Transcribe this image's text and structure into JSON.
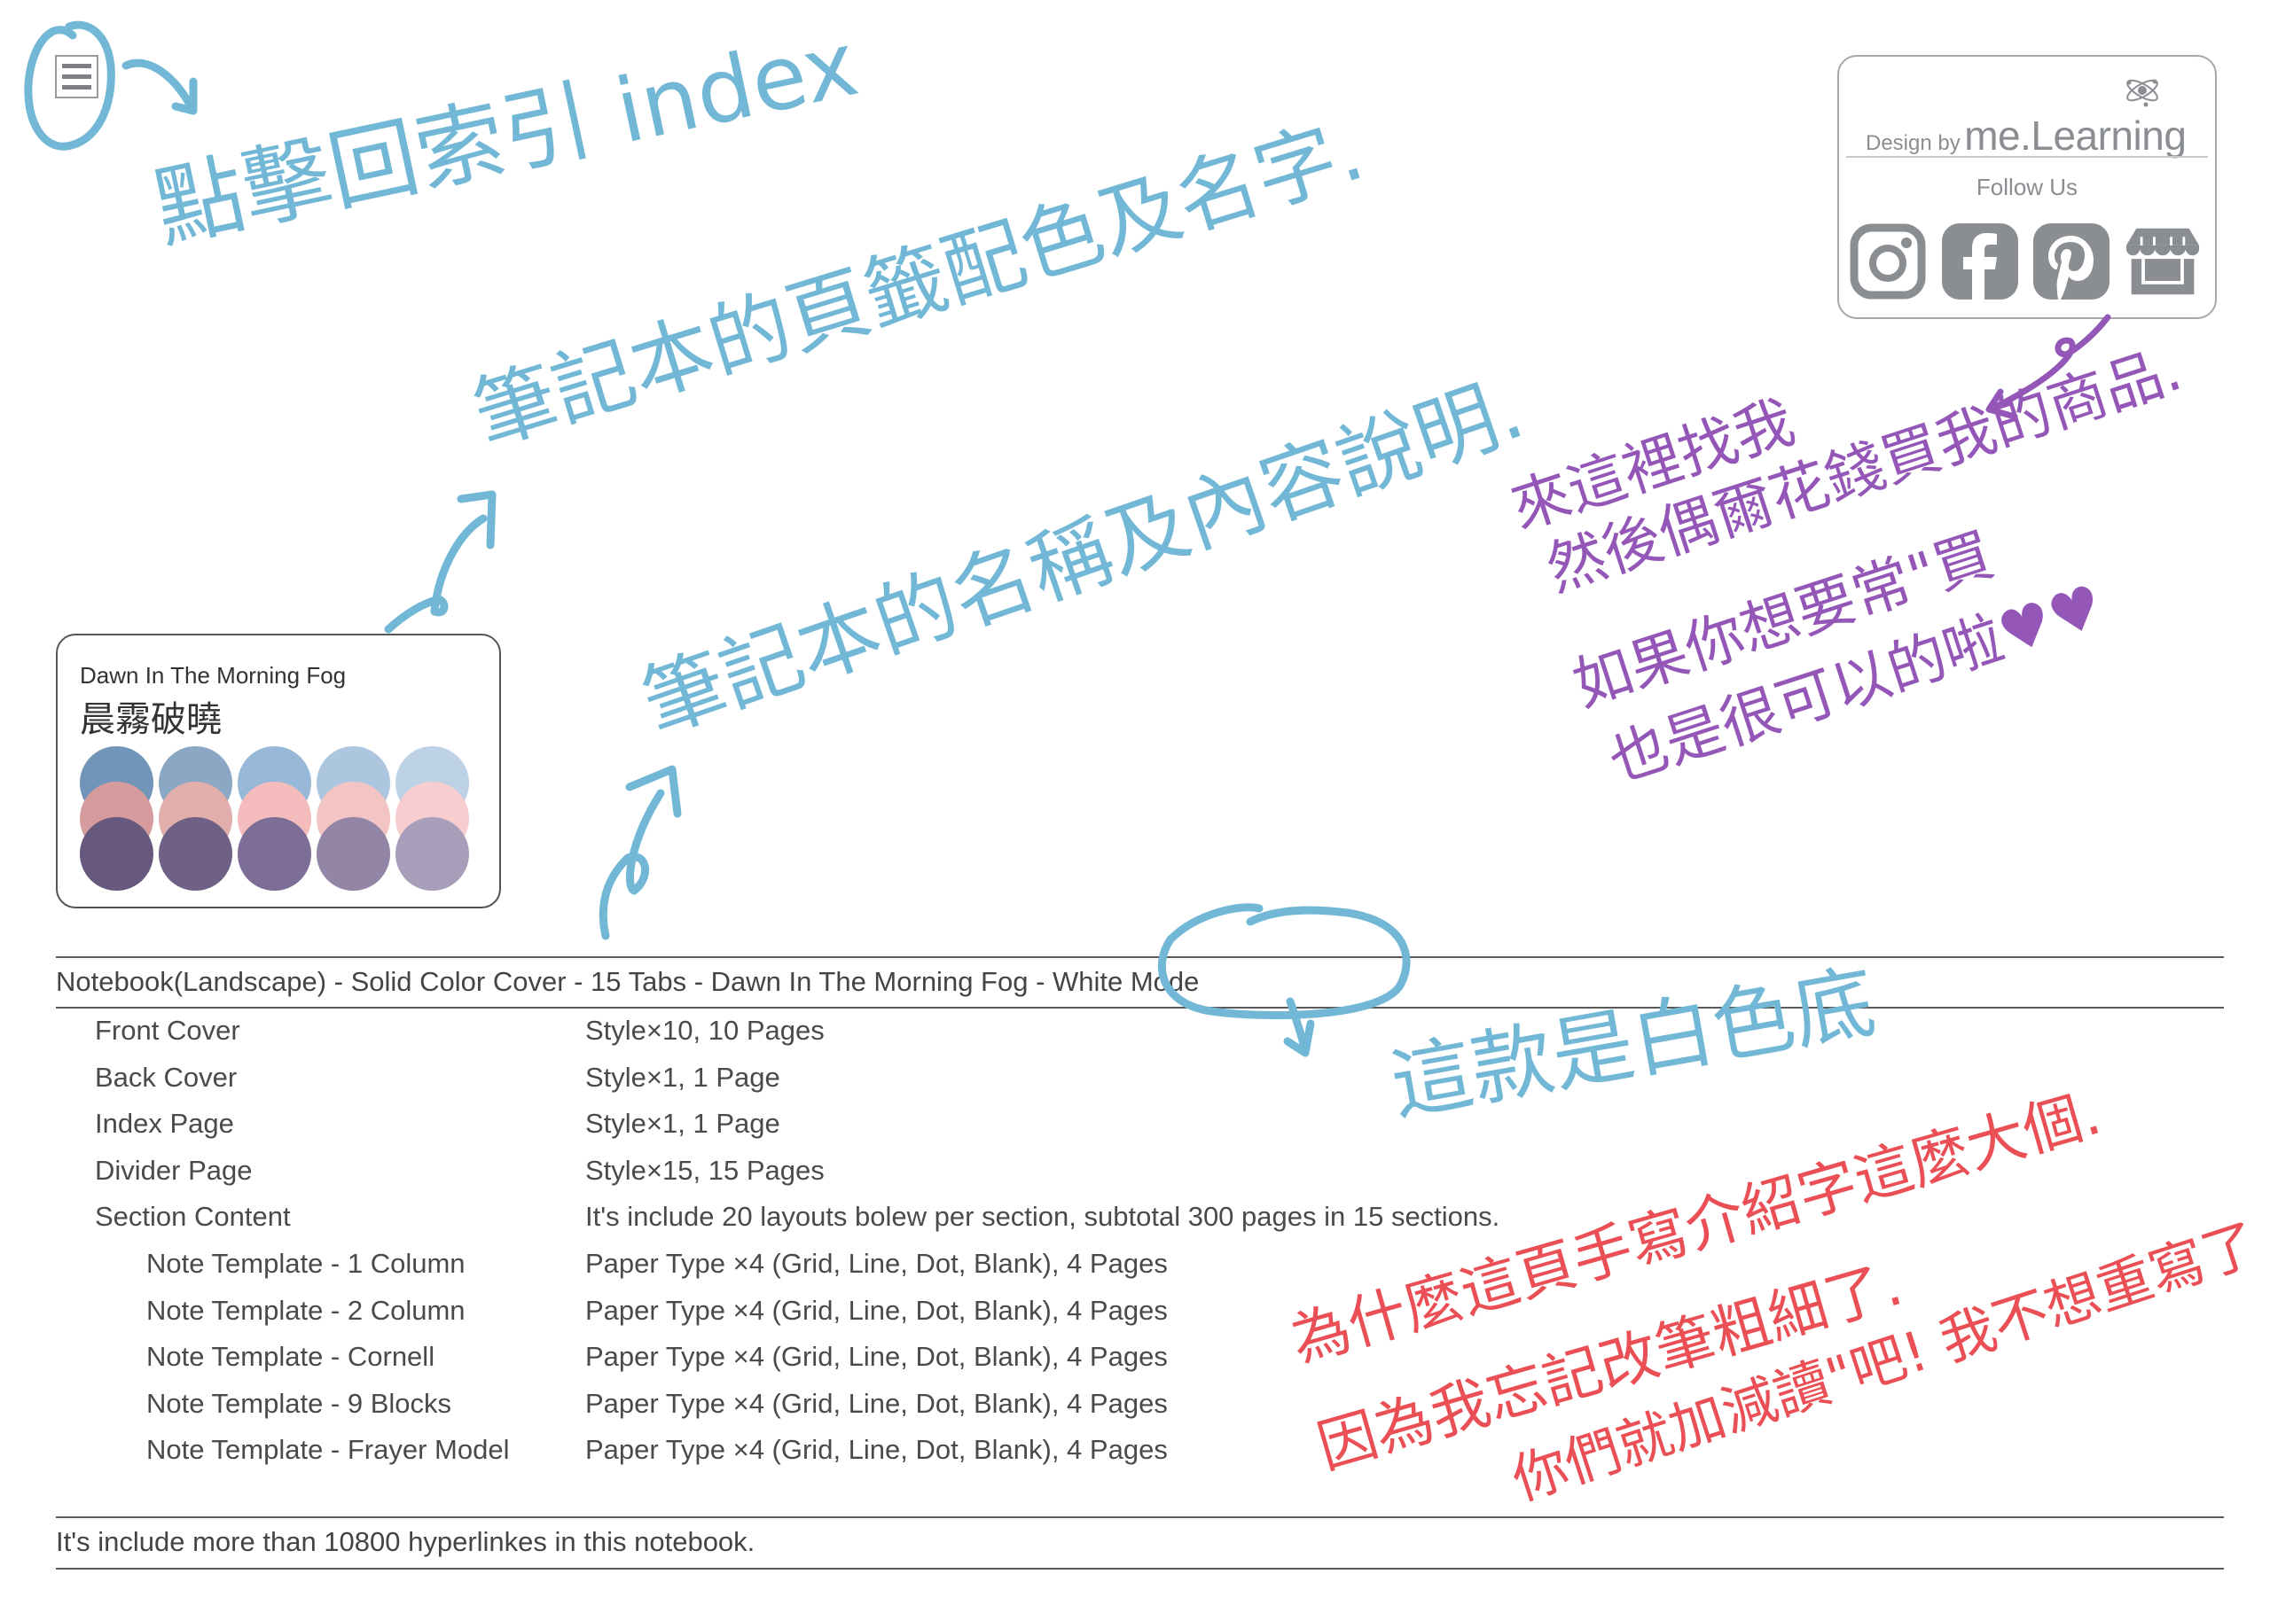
{
  "index_button": {
    "icon": "hamburger-menu-icon"
  },
  "brand_card": {
    "design_by_prefix": "Design by",
    "brand_name": "me.Learning",
    "follow_label": "Follow Us",
    "social_links": [
      {
        "name": "Instagram",
        "icon": "instagram-icon"
      },
      {
        "name": "Facebook",
        "icon": "facebook-icon"
      },
      {
        "name": "Pinterest",
        "icon": "pinterest-icon"
      },
      {
        "name": "Shop",
        "icon": "shop-icon"
      }
    ],
    "icon_color": "#8a8d91"
  },
  "palette": {
    "name_en": "Dawn In The Morning Fog",
    "name_zh": "晨霧破曉",
    "rows": [
      [
        "#7095b8",
        "#8aa8c4",
        "#97b8d8",
        "#adc6df",
        "#bed2e6"
      ],
      [
        "#d69c9d",
        "#e2aeac",
        "#f4bcbc",
        "#f3c4c4",
        "#f7cdcf"
      ],
      [
        "#67587e",
        "#6f6186",
        "#7c6e96",
        "#9285a6",
        "#a89eb9"
      ]
    ]
  },
  "notebook": {
    "title": "Notebook(Landscape) - Solid Color Cover - 15 Tabs - Dawn In The Morning Fog - White Mode",
    "specs": [
      {
        "label": "Front Cover",
        "value": "Style×10, 10 Pages",
        "indent": 0
      },
      {
        "label": "Back Cover",
        "value": "Style×1, 1 Page",
        "indent": 0
      },
      {
        "label": "Index Page",
        "value": "Style×1, 1 Page",
        "indent": 0
      },
      {
        "label": "Divider Page",
        "value": "Style×15, 15 Pages",
        "indent": 0
      },
      {
        "label": "Section Content",
        "value": "It's include 20 layouts bolew per section, subtotal 300 pages in 15 sections.",
        "indent": 0
      },
      {
        "label": "Note Template - 1 Column",
        "value": "Paper Type ×4 (Grid, Line, Dot, Blank), 4 Pages",
        "indent": 1
      },
      {
        "label": "Note Template - 2 Column",
        "value": "Paper Type ×4 (Grid, Line, Dot, Blank), 4 Pages",
        "indent": 1
      },
      {
        "label": "Note Template - Cornell",
        "value": "Paper Type ×4 (Grid, Line, Dot, Blank), 4 Pages",
        "indent": 1
      },
      {
        "label": "Note Template - 9 Blocks",
        "value": "Paper Type ×4 (Grid, Line, Dot, Blank), 4 Pages",
        "indent": 1
      },
      {
        "label": "Note Template - Frayer Model",
        "value": "Paper Type ×4 (Grid, Line, Dot, Blank), 4 Pages",
        "indent": 1
      }
    ],
    "footer_note": "It's include more than 10800 hyperlinkes in this notebook."
  },
  "annotations": {
    "colors": {
      "blue": "#72b8d6",
      "purple": "#9457b8",
      "red": "#ea4f55"
    },
    "index_hint": "點擊回索引 index",
    "tab_colors_hint": "筆記本的頁籤配色及名字.",
    "name_desc_hint": "筆記本的名稱及內容說明.",
    "white_mode_hint": "這款是白色底",
    "shop_hint": [
      "來這裡找我",
      "然後偶爾花錢買我的商品.",
      "如果你想要常\"買",
      "也是很可以的啦♥♥"
    ],
    "apology": [
      "為什麼這頁手寫介紹字這麼大個.",
      "因為我忘記改筆粗細了.",
      "你們就加減讀\"吧! 我不想重寫了"
    ]
  }
}
